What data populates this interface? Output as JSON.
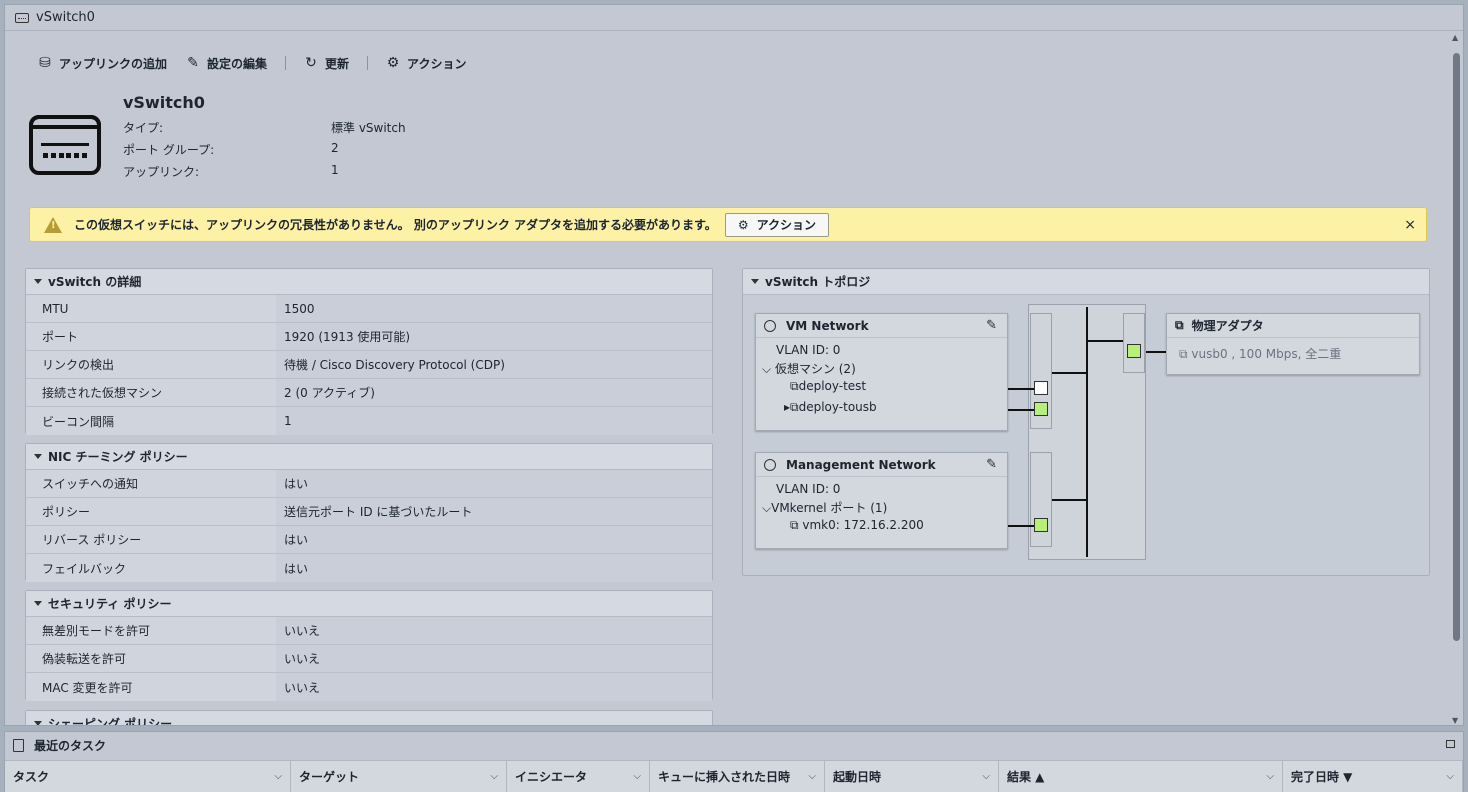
{
  "window": {
    "title": "vSwitch0"
  },
  "toolbar": {
    "add_uplink": "アップリンクの追加",
    "edit_settings": "設定の編集",
    "refresh": "更新",
    "actions": "アクション"
  },
  "header": {
    "name": "vSwitch0",
    "type_label": "タイプ:",
    "type_value": "標準 vSwitch",
    "pg_label": "ポート グループ:",
    "pg_value": "2",
    "uplink_label": "アップリンク:",
    "uplink_value": "1"
  },
  "warning": {
    "text": "この仮想スイッチには、アップリンクの冗長性がありません。 別のアップリンク アダプタを追加する必要があります。",
    "action": "アクション",
    "close": "×"
  },
  "details": {
    "title": "vSwitch の詳細",
    "rows": [
      [
        "MTU",
        "1500"
      ],
      [
        "ポート",
        "1920 (1913 使用可能)"
      ],
      [
        "リンクの検出",
        "待機 / Cisco Discovery Protocol (CDP)"
      ],
      [
        "接続された仮想マシン",
        "2 (0 アクティブ)"
      ],
      [
        "ビーコン間隔",
        "1"
      ]
    ]
  },
  "nic": {
    "title": "NIC チーミング ポリシー",
    "rows": [
      [
        "スイッチへの通知",
        "はい"
      ],
      [
        "ポリシー",
        "送信元ポート ID に基づいたルート"
      ],
      [
        "リバース ポリシー",
        "はい"
      ],
      [
        "フェイルバック",
        "はい"
      ]
    ]
  },
  "security": {
    "title": "セキュリティ ポリシー",
    "rows": [
      [
        "無差別モードを許可",
        "いいえ"
      ],
      [
        "偽装転送を許可",
        "いいえ"
      ],
      [
        "MAC 変更を許可",
        "いいえ"
      ]
    ]
  },
  "shaping": {
    "title": "シェーピング ポリシー"
  },
  "topology": {
    "title": "vSwitch トポロジ",
    "vm_network": {
      "name": "VM Network",
      "vlan": "VLAN ID: 0",
      "vms": "仮想マシン (2)",
      "vm1": "deploy-test",
      "vm2": "deploy-tousb"
    },
    "mgmt": {
      "name": "Management Network",
      "vlan": "VLAN ID: 0",
      "vmk": "VMkernel ポート (1)",
      "vmk0": "vmk0: 172.16.2.200"
    },
    "physical": {
      "title": "物理アダプタ",
      "nic": "vusb0 , 100 Mbps, 全二重"
    }
  },
  "tasks": {
    "title": "最近のタスク",
    "columns": [
      "タスク",
      "ターゲット",
      "イニシエータ",
      "キューに挿入された日時",
      "起動日時",
      "結果 ▲",
      "完了日時 ▼"
    ]
  },
  "colors": {
    "warning_bg": "#fdf1a6",
    "port_active": "#b8ee7a",
    "panel_bg": "#c3c8d3"
  }
}
